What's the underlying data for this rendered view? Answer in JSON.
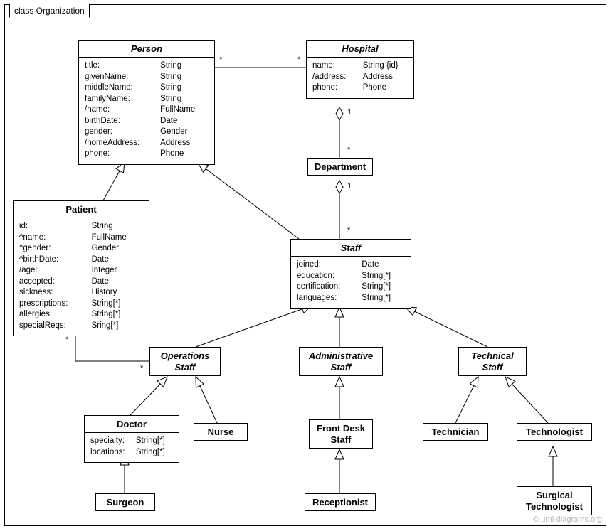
{
  "frame": {
    "title": "class Organization"
  },
  "watermark": "© uml-diagrams.org",
  "classes": {
    "person": {
      "name": "Person",
      "attrs": [
        [
          "title:",
          "String"
        ],
        [
          "givenName:",
          "String"
        ],
        [
          "middleName:",
          "String"
        ],
        [
          "familyName:",
          "String"
        ],
        [
          "/name:",
          "FullName"
        ],
        [
          "birthDate:",
          "Date"
        ],
        [
          "gender:",
          "Gender"
        ],
        [
          "/homeAddress:",
          "Address"
        ],
        [
          "phone:",
          "Phone"
        ]
      ]
    },
    "hospital": {
      "name": "Hospital",
      "attrs": [
        [
          "name:",
          "String {id}"
        ],
        [
          "/address:",
          "Address"
        ],
        [
          "phone:",
          "Phone"
        ]
      ]
    },
    "department": {
      "name": "Department"
    },
    "patient": {
      "name": "Patient",
      "attrs": [
        [
          "id:",
          "String"
        ],
        [
          "^name:",
          "FullName"
        ],
        [
          "^gender:",
          "Gender"
        ],
        [
          "^birthDate:",
          "Date"
        ],
        [
          "/age:",
          "Integer"
        ],
        [
          "accepted:",
          "Date"
        ],
        [
          "sickness:",
          "History"
        ],
        [
          "prescriptions:",
          "String[*]"
        ],
        [
          "allergies:",
          "String[*]"
        ],
        [
          "specialReqs:",
          "Sring[*]"
        ]
      ]
    },
    "staff": {
      "name": "Staff",
      "attrs": [
        [
          "joined:",
          "Date"
        ],
        [
          "education:",
          "String[*]"
        ],
        [
          "certification:",
          "String[*]"
        ],
        [
          "languages:",
          "String[*]"
        ]
      ]
    },
    "opsStaff": {
      "name1": "Operations",
      "name2": "Staff"
    },
    "adminStaff": {
      "name1": "Administrative",
      "name2": "Staff"
    },
    "techStaff": {
      "name1": "Technical",
      "name2": "Staff"
    },
    "doctor": {
      "name": "Doctor",
      "attrs": [
        [
          "specialty:",
          "String[*]"
        ],
        [
          "locations:",
          "String[*]"
        ]
      ]
    },
    "nurse": {
      "name": "Nurse"
    },
    "frontDesk": {
      "name1": "Front Desk",
      "name2": "Staff"
    },
    "technician": {
      "name": "Technician"
    },
    "technologist": {
      "name": "Technologist"
    },
    "surgeon": {
      "name": "Surgeon"
    },
    "receptionist": {
      "name": "Receptionist"
    },
    "surgTech": {
      "name1": "Surgical",
      "name2": "Technologist"
    }
  },
  "multiplicities": {
    "person_hospital_left": "*",
    "person_hospital_right": "*",
    "hospital_dept_top": "1",
    "hospital_dept_bottom": "*",
    "dept_staff_top": "1",
    "dept_staff_bottom": "*",
    "patient_ops_top": "*",
    "patient_ops_bottom": "*"
  }
}
